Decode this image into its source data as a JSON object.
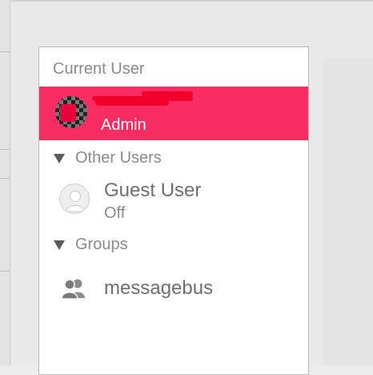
{
  "sidebar": {
    "current_user_header": "Current User",
    "current_user": {
      "name_redacted": true,
      "role": "Admin"
    },
    "other_users_header": "Other Users",
    "guest": {
      "name": "Guest User",
      "status": "Off"
    },
    "groups_header": "Groups",
    "group": {
      "name": "messagebus"
    }
  },
  "colors": {
    "selection": "#fa2d63",
    "redaction": "#f0002a"
  },
  "icons": {
    "admin_avatar": "checkered-avatar-icon",
    "guest_avatar": "generic-user-icon",
    "group": "group-people-icon",
    "disclosure": "disclosure-triangle-icon"
  }
}
